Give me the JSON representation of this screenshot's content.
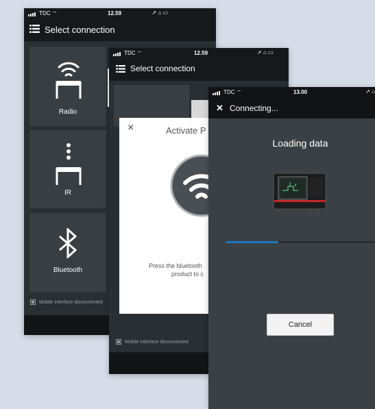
{
  "screen1": {
    "status": {
      "carrier": "TDC",
      "time": "12.59"
    },
    "header_title": "Select connection",
    "tiles": [
      {
        "label": "Radio",
        "icon": "radio-icon"
      },
      {
        "label": "IR",
        "icon": "ir-icon"
      },
      {
        "label": "Bluetooth",
        "icon": "bluetooth-icon"
      }
    ],
    "footer_note": "Mobile interface disconnected"
  },
  "screen2": {
    "status": {
      "carrier": "TDC",
      "time": "12.59"
    },
    "header_title": "Select connection",
    "modal": {
      "close": "×",
      "title": "Activate P",
      "body_line1": "Press the bluetooth",
      "body_line2": "product to c"
    },
    "footer_note": "Mobile interface disconnected"
  },
  "screen3": {
    "status": {
      "carrier": "TDC",
      "time": "13.00"
    },
    "header_close": "✕",
    "header_title": "Connecting...",
    "loading_title": "Loading data",
    "progress": 0.35,
    "cancel_label": "Cancel",
    "progress_color": "#1c77c3"
  }
}
